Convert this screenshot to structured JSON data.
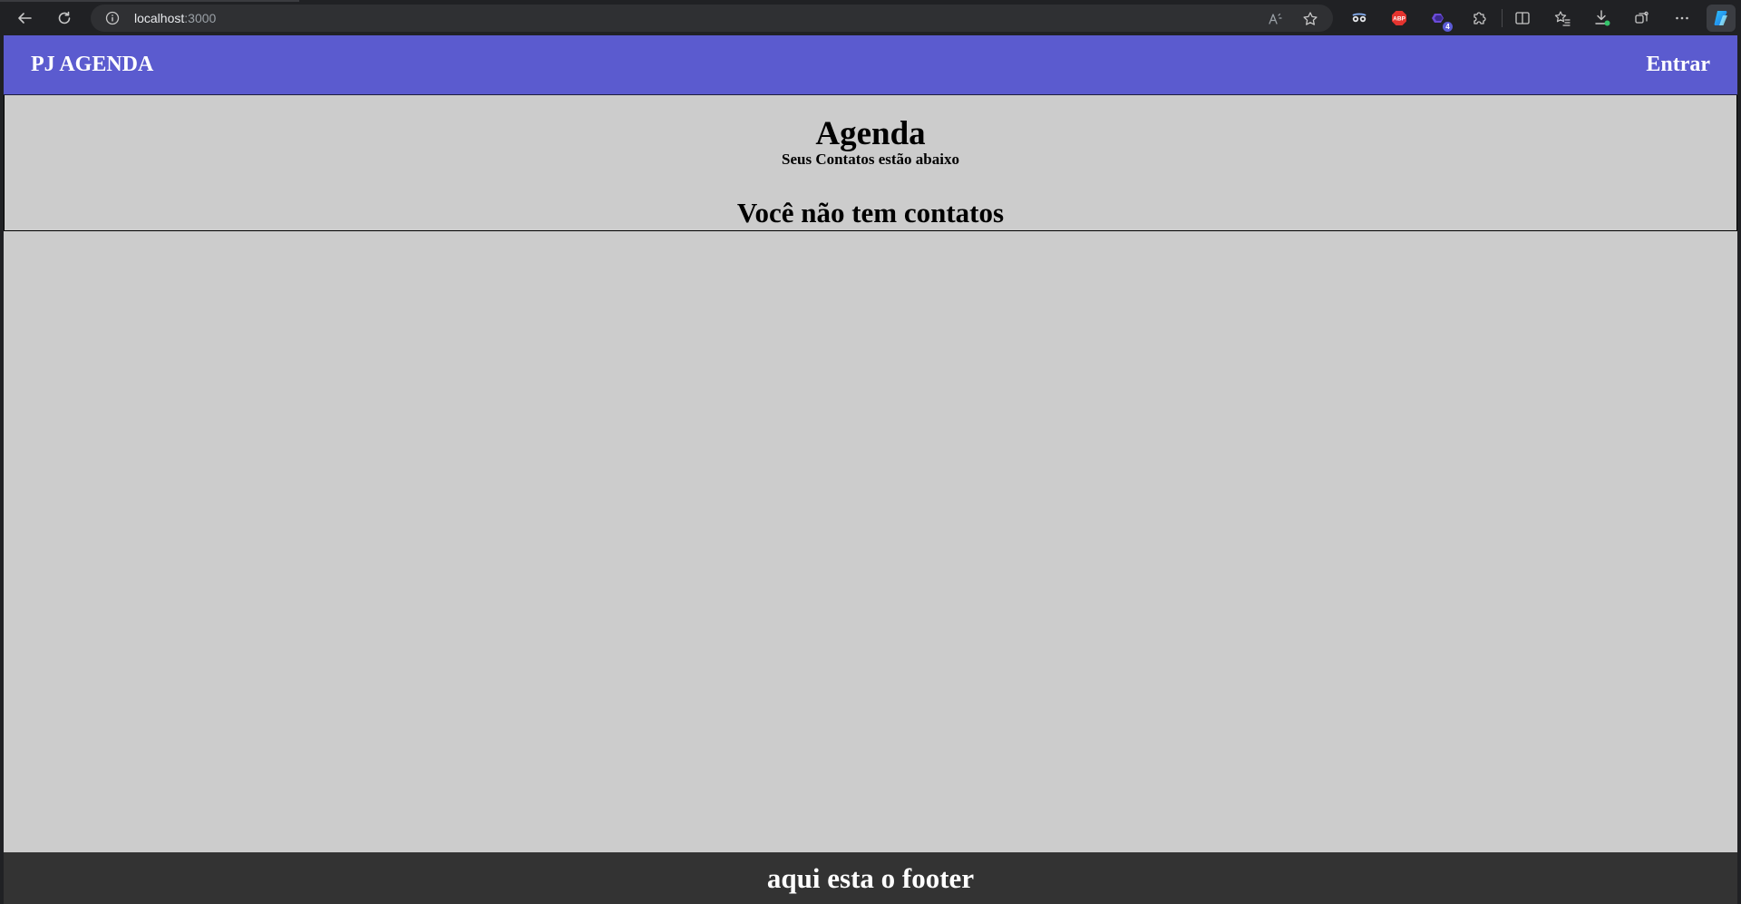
{
  "browser": {
    "url_host": "localhost",
    "url_port": ":3000",
    "extension_badge_count": "4",
    "icons": {
      "back": "back-arrow-icon",
      "reload": "reload-icon",
      "site_info": "info-icon",
      "read_aloud": "read-aloud-icon",
      "favorite": "star-icon",
      "extension_1": "glasses-extension-icon",
      "extension_2": "adblock-plus-icon",
      "extension_3": "shape-extension-icon",
      "extensions": "puzzle-icon",
      "split_screen": "split-screen-icon",
      "favorites": "favorites-icon",
      "downloads": "download-icon",
      "collections": "collections-icon",
      "more": "more-icon",
      "copilot": "copilot-icon"
    }
  },
  "header": {
    "brand": "PJ AGENDA",
    "login_link": "Entrar"
  },
  "main": {
    "title": "Agenda",
    "subtitle": "Seus Contatos estão abaixo",
    "empty_message": "Você não tem contatos"
  },
  "footer": {
    "text": "aqui esta o footer"
  },
  "colors": {
    "header_bg": "#5b5bcf",
    "page_bg": "#cccccc",
    "footer_bg": "#333333",
    "browser_bg": "#202124"
  }
}
